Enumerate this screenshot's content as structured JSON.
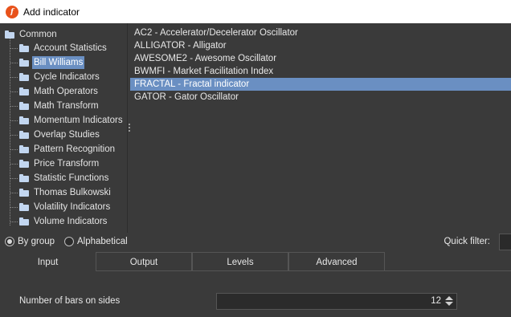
{
  "window": {
    "title": "Add indicator",
    "logo_text": "f"
  },
  "tree": {
    "root_label": "Common",
    "items": [
      {
        "label": "Account Statistics"
      },
      {
        "label": "Bill Williams",
        "selected": true
      },
      {
        "label": "Cycle Indicators"
      },
      {
        "label": "Math Operators"
      },
      {
        "label": "Math Transform"
      },
      {
        "label": "Momentum Indicators"
      },
      {
        "label": "Overlap Studies"
      },
      {
        "label": "Pattern Recognition"
      },
      {
        "label": "Price Transform"
      },
      {
        "label": "Statistic Functions"
      },
      {
        "label": "Thomas Bulkowski"
      },
      {
        "label": "Volatility Indicators"
      },
      {
        "label": "Volume Indicators"
      }
    ]
  },
  "indicators": [
    {
      "label": "AC2 - Accelerator/Decelerator Oscillator"
    },
    {
      "label": "ALLIGATOR - Alligator"
    },
    {
      "label": "AWESOME2 - Awesome Oscillator"
    },
    {
      "label": "BWMFI - Market Facilitation Index"
    },
    {
      "label": "FRACTAL - Fractal indicator",
      "selected": true
    },
    {
      "label": "GATOR - Gator Oscillator"
    }
  ],
  "grouping": {
    "by_group_label": "By group",
    "alphabetical_label": "Alphabetical",
    "selected": "by_group"
  },
  "quick_filter": {
    "label": "Quick filter:",
    "value": ""
  },
  "tabs": [
    {
      "label": "Input",
      "active": true
    },
    {
      "label": "Output"
    },
    {
      "label": "Levels"
    },
    {
      "label": "Advanced"
    }
  ],
  "params": {
    "bars_label": "Number of bars on sides",
    "bars_value": "12"
  },
  "colors": {
    "selection": "#6a8fc2",
    "background": "#3a3a3a",
    "logo": "#e8521b"
  }
}
